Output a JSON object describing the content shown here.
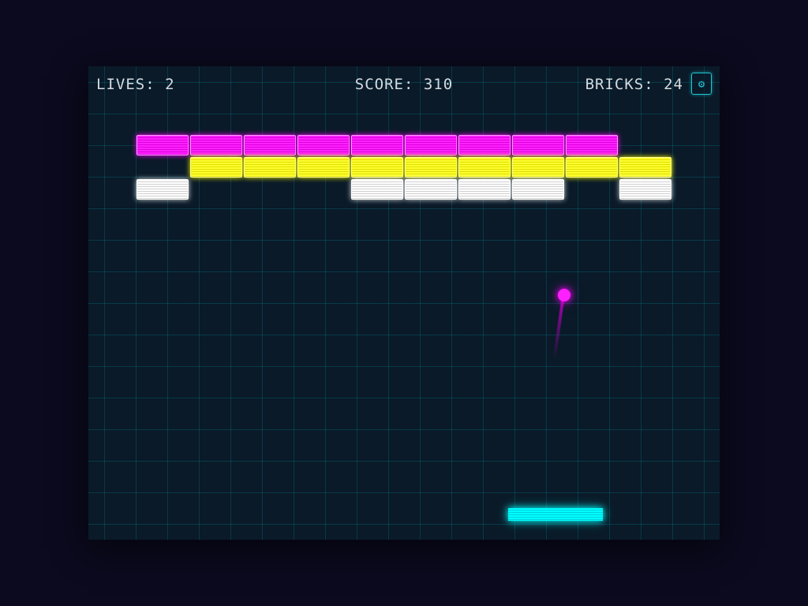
{
  "hud": {
    "lives_label": "LIVES: 2",
    "score_label": "SCORE: 310",
    "bricks_label": "BRICKS: 24"
  },
  "settings_icon": "⚙",
  "colors": {
    "magenta": "#ff00ff",
    "yellow": "#ffff00",
    "white": "#ffffff",
    "cyan": "#00ffff",
    "grid": "#00aabe",
    "background": "#0b0a1e"
  },
  "brick_rows": [
    {
      "color": "magenta",
      "filled": [
        true,
        true,
        true,
        true,
        true,
        true,
        true,
        true,
        true,
        false
      ]
    },
    {
      "color": "yellow",
      "filled": [
        false,
        true,
        true,
        true,
        true,
        true,
        true,
        true,
        true,
        true
      ]
    },
    {
      "color": "white",
      "filled": [
        true,
        false,
        false,
        false,
        true,
        true,
        true,
        true,
        false,
        true
      ]
    }
  ]
}
